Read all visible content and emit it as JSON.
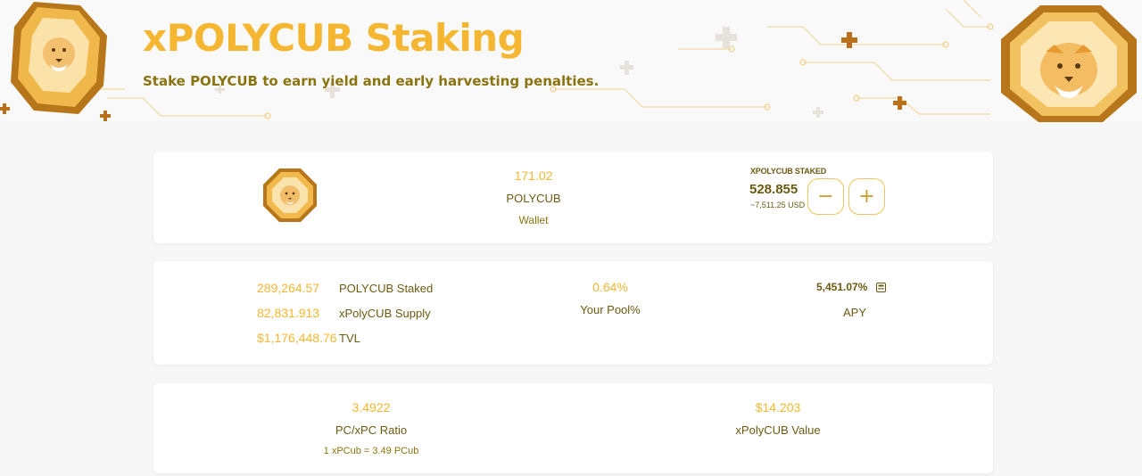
{
  "header": {
    "title": "xPOLYCUB Staking",
    "subtitle": "Stake POLYCUB to earn yield and early harvesting penalties."
  },
  "wallet_card": {
    "wallet_amount": "171.02",
    "token": "POLYCUB",
    "wallet_label": "Wallet",
    "staked_label": "XPOLYCUB STAKED",
    "staked_amount": "528.855",
    "staked_usd": "~7,511.25 USD",
    "minus_label": "−",
    "plus_label": "+"
  },
  "stats_card": {
    "rows": [
      {
        "value": "289,264.57",
        "label": "POLYCUB Staked"
      },
      {
        "value": "82,831.913",
        "label": "xPolyCUB Supply"
      },
      {
        "value": "$1,176,448.76",
        "label": "TVL"
      }
    ],
    "pool_value": "0.64%",
    "pool_label": "Your Pool%",
    "apy_value": "5,451.07%",
    "apy_label": "APY",
    "apy_icon": "calculator-icon"
  },
  "ratio_card": {
    "ratio_value": "3.4922",
    "ratio_label": "PC/xPC Ratio",
    "ratio_note": "1 xPCub = 3.49 PCub",
    "xvalue_value": "$14.203",
    "xvalue_label": "xPolyCUB Value"
  },
  "colors": {
    "accent": "#f5b731",
    "text_dark": "#6b5a12",
    "text_mid": "#8a7410",
    "background": "#f7f7f7"
  }
}
